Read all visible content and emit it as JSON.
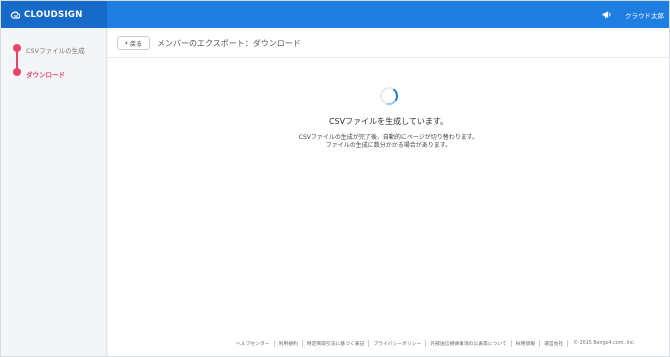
{
  "header": {
    "logo_text": "CLOUDSIGN",
    "user_name": "クラウド太郎",
    "colors": {
      "bar": "#1f7ee1",
      "logo_bg": "#176bc8",
      "accent": "#e8456b"
    }
  },
  "sidebar": {
    "steps": [
      {
        "label": "CSVファイルの生成",
        "state": "done"
      },
      {
        "label": "ダウンロード",
        "state": "active"
      }
    ]
  },
  "main": {
    "back_label": "戻る",
    "title": "メンバーのエクスポート：ダウンロード",
    "status_title": "CSVファイルを生成しています。",
    "status_lines": [
      "CSVファイルの生成が完了後、自動的にページが切り替わります。",
      "ファイルの生成に数分かかる場合があります。"
    ]
  },
  "footer": {
    "links": [
      "ヘルプセンター",
      "利用規約",
      "特定商取引法に基づく表記",
      "プライバシーポリシー",
      "外部送信規律事項の公表等について",
      "採用情報",
      "運営会社"
    ],
    "copyright": "© 2015 Bengo4.com, Inc."
  },
  "icons": [
    "cloud-logo-icon",
    "megaphone-icon",
    "chevron-left-icon",
    "loading-spinner-icon"
  ]
}
